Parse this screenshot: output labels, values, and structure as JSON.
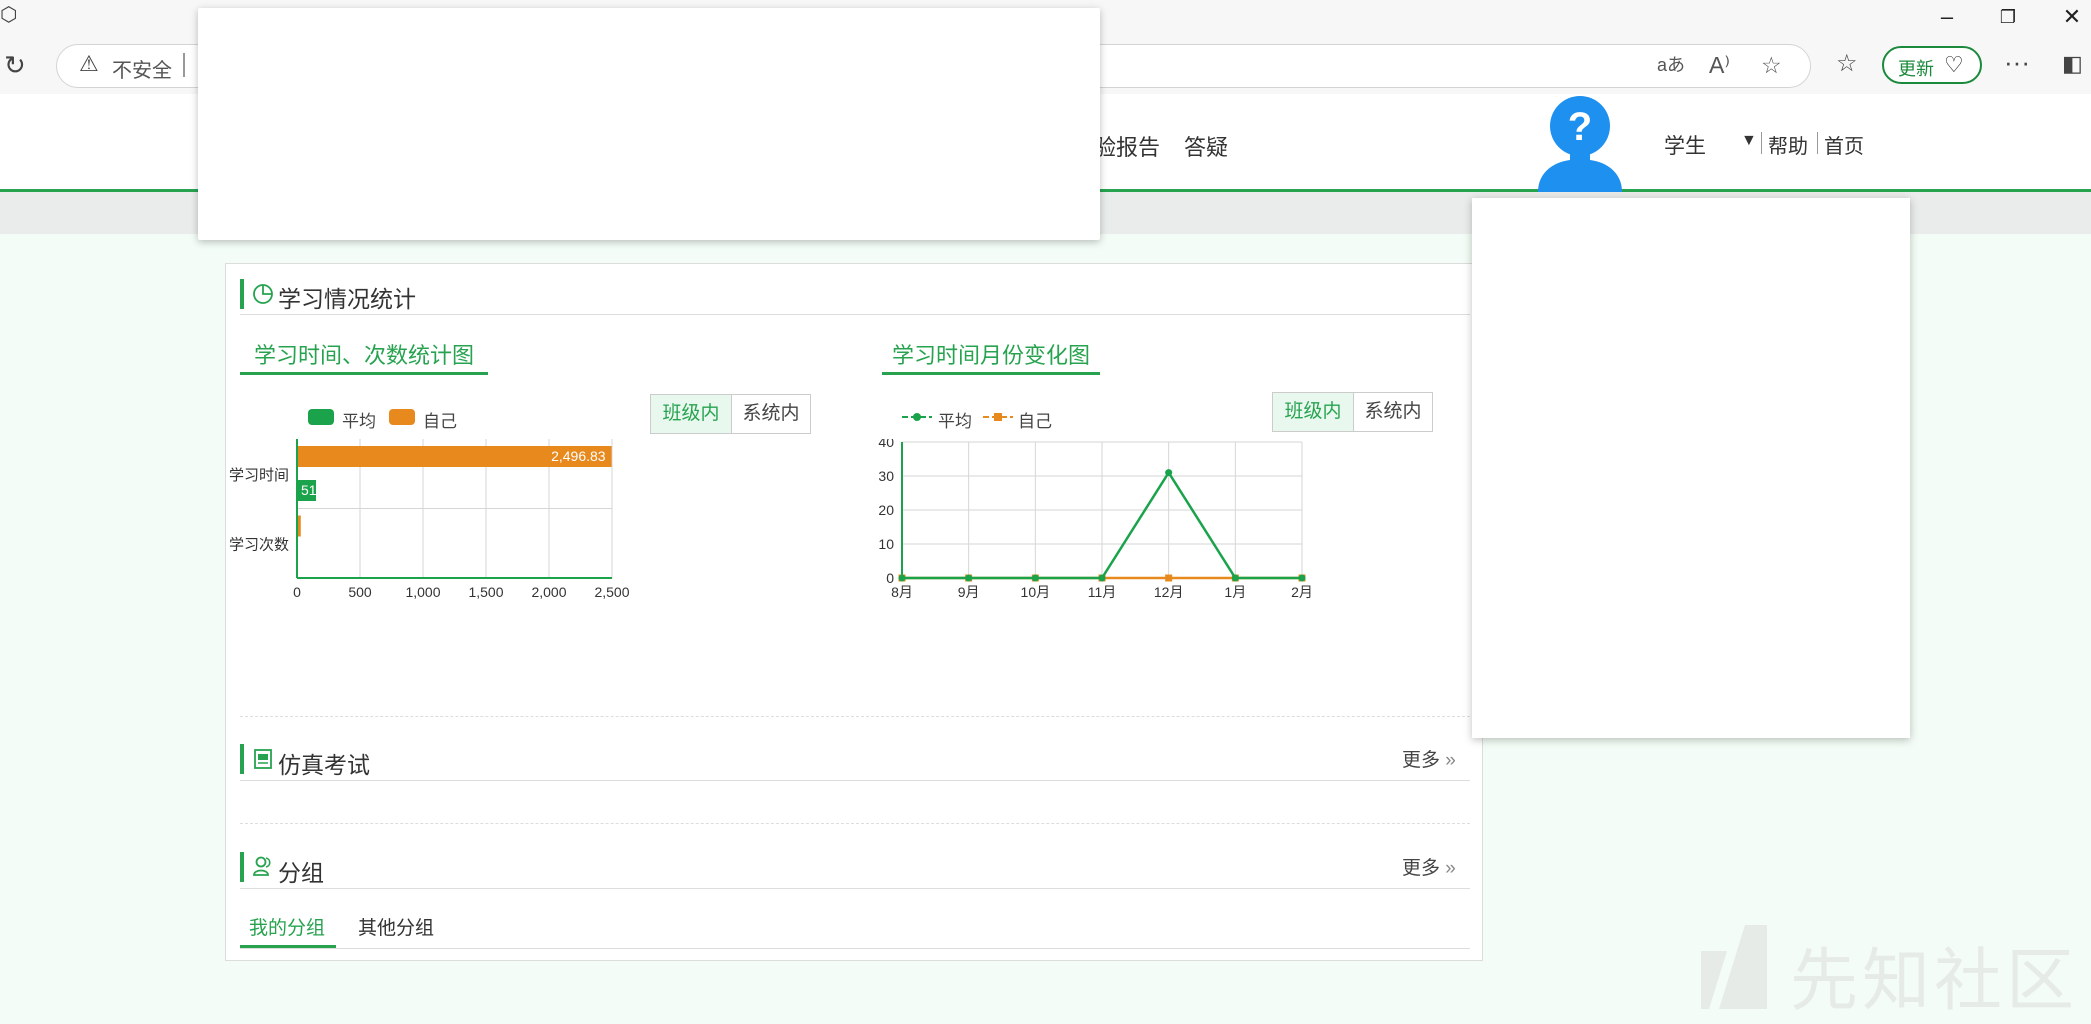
{
  "browser": {
    "insecure_label": "不安全",
    "update_label": "更新",
    "colors": {
      "accent": "#1b8a3c"
    }
  },
  "site": {
    "nav": {
      "report_partial": "验报告",
      "qa": "答疑"
    },
    "role": "学生",
    "help": "帮助",
    "home": "首页"
  },
  "stats": {
    "title": "学习情况统计",
    "bar_chart_title": "学习时间、次数统计图",
    "line_chart_title": "学习时间月份变化图",
    "legend_avg": "平均",
    "legend_self": "自己",
    "toggle_class": "班级内",
    "toggle_system": "系统内"
  },
  "exam": {
    "title": "仿真考试",
    "more": "更多"
  },
  "group": {
    "title": "分组",
    "more": "更多",
    "tabs": [
      "我的分组",
      "其他分组"
    ]
  },
  "watermark": "先知社区",
  "chart_data": [
    {
      "type": "bar",
      "orientation": "horizontal",
      "title": "学习时间、次数统计图",
      "categories": [
        "学习时间",
        "学习次数"
      ],
      "series": [
        {
          "name": "自己",
          "color": "#e8891d",
          "values": [
            2496.83,
            30
          ],
          "labels": [
            "2,496.83",
            ""
          ]
        },
        {
          "name": "平均",
          "color": "#1aa34a",
          "values": [
            151,
            0
          ],
          "labels": [
            "51",
            ""
          ]
        }
      ],
      "xlim": [
        0,
        2500
      ],
      "xticks": [
        "0",
        "500",
        "1,000",
        "1,500",
        "2,000",
        "2,500"
      ],
      "grid": true,
      "legend": "top-left"
    },
    {
      "type": "line",
      "title": "学习时间月份变化图",
      "x": [
        "8月",
        "9月",
        "10月",
        "11月",
        "12月",
        "1月",
        "2月"
      ],
      "series": [
        {
          "name": "平均",
          "color": "#1aa34a",
          "values": [
            0,
            0,
            0,
            0,
            31,
            0,
            0
          ]
        },
        {
          "name": "自己",
          "color": "#e8891d",
          "values": [
            0,
            0,
            0,
            0,
            0,
            0,
            0
          ]
        }
      ],
      "ylim": [
        0,
        40
      ],
      "yticks": [
        "0",
        "10",
        "20",
        "30",
        "40"
      ],
      "grid": true,
      "legend": "top-left"
    }
  ]
}
